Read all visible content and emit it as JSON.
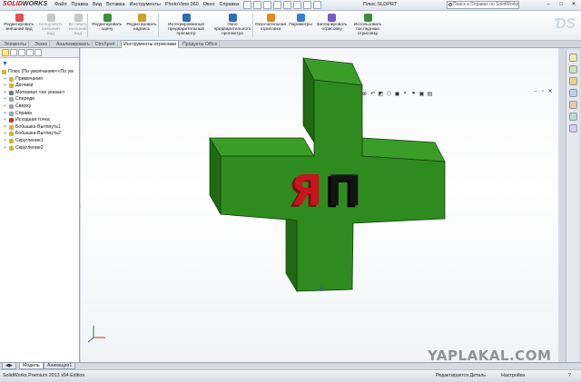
{
  "app": {
    "logo_brand": "SOLID",
    "logo_suffix": "WORKS",
    "document_title": "Плюс.SLDPRT",
    "search_placeholder": "Поиск в Справке по SolidWorks"
  },
  "menu": [
    "Файл",
    "Правка",
    "Вид",
    "Вставка",
    "Инструменты",
    "PhotoView 360",
    "Окно",
    "Справка"
  ],
  "ribbon": [
    {
      "label": "Редактировать\nвнешний вид",
      "icon": "appearance-icon",
      "disabled": false,
      "color": "#d9534f"
    },
    {
      "label": "Копировать\nвнешний\nвид",
      "icon": "copy-appearance-icon",
      "disabled": true,
      "color": "#8a8a8a"
    },
    {
      "label": "Вставить\nвнешний\nвид",
      "icon": "paste-appearance-icon",
      "disabled": true,
      "color": "#8a8a8a"
    },
    {
      "label": "Редактировать\nсцену",
      "icon": "scene-icon",
      "disabled": false,
      "color": "#3c8f3c"
    },
    {
      "label": "Редактировать\nнадпись",
      "icon": "decal-icon",
      "disabled": false,
      "color": "#c9a227"
    },
    {
      "label": "Интегрированный\nпредварительный\nпросмотр",
      "icon": "integrated-preview-icon",
      "disabled": false,
      "color": "#2f6db5"
    },
    {
      "label": "Окно\nпредварительного\nпросмотра",
      "icon": "preview-window-icon",
      "disabled": false,
      "color": "#2f6db5"
    },
    {
      "label": "Окончательная\nотрисовка",
      "icon": "final-render-icon",
      "disabled": false,
      "color": "#e08a1e"
    },
    {
      "label": "Параметры",
      "icon": "options-icon",
      "disabled": false,
      "color": "#3a7dc9"
    },
    {
      "label": "Запланировать\nотрисовку",
      "icon": "schedule-render-icon",
      "disabled": false,
      "color": "#7a5cc4"
    },
    {
      "label": "Использовать\nпоследнюю\nотрисовку",
      "icon": "recall-render-icon",
      "disabled": false,
      "color": "#3c8f3c"
    }
  ],
  "tabs": [
    "Элементы",
    "Эскиз",
    "Анализировать",
    "DimXpert",
    "Инструменты отрисовки",
    "Продукты Office"
  ],
  "active_tab": "Инструменты отрисовки",
  "tree": {
    "root": "Плюс  (По умолчанию<<По ум",
    "items": [
      {
        "label": "Примечания",
        "icon": "annotations-icon",
        "color": "#d8b03c"
      },
      {
        "label": "Датчики",
        "icon": "sensors-icon",
        "color": "#d8b03c"
      },
      {
        "label": "Материал <не указан>",
        "icon": "material-icon",
        "color": "#6e7c8e"
      },
      {
        "label": "Спереди",
        "icon": "plane-front-icon",
        "color": "#9aa4b2"
      },
      {
        "label": "Сверху",
        "icon": "plane-top-icon",
        "color": "#9aa4b2"
      },
      {
        "label": "Справа",
        "icon": "plane-right-icon",
        "color": "#9aa4b2"
      },
      {
        "label": "Исходная точка",
        "icon": "origin-icon",
        "color": "#c0392b"
      },
      {
        "label": "Бобышка-Вытянуть1",
        "icon": "extrude-icon",
        "color": "#d8b03c"
      },
      {
        "label": "Бобышка-Вытянуть2",
        "icon": "extrude-icon",
        "color": "#d8b03c"
      },
      {
        "label": "Скругление1",
        "icon": "fillet-icon",
        "color": "#d8b03c"
      },
      {
        "label": "Скругление2",
        "icon": "fillet-icon",
        "color": "#d8b03c"
      }
    ]
  },
  "model": {
    "text": "ЯП",
    "body_color": "#2e8b1e",
    "text_color_1": "#c4161c",
    "text_color_2": "#111111"
  },
  "bottom_tabs": [
    "Модель",
    "Анимация1"
  ],
  "status": {
    "edition": "SolidWorks Premium 2013 x64 Edition",
    "editing": "Редактируется Деталь",
    "custom": "Настройка"
  },
  "watermark": "YAPLAKAL.COM"
}
